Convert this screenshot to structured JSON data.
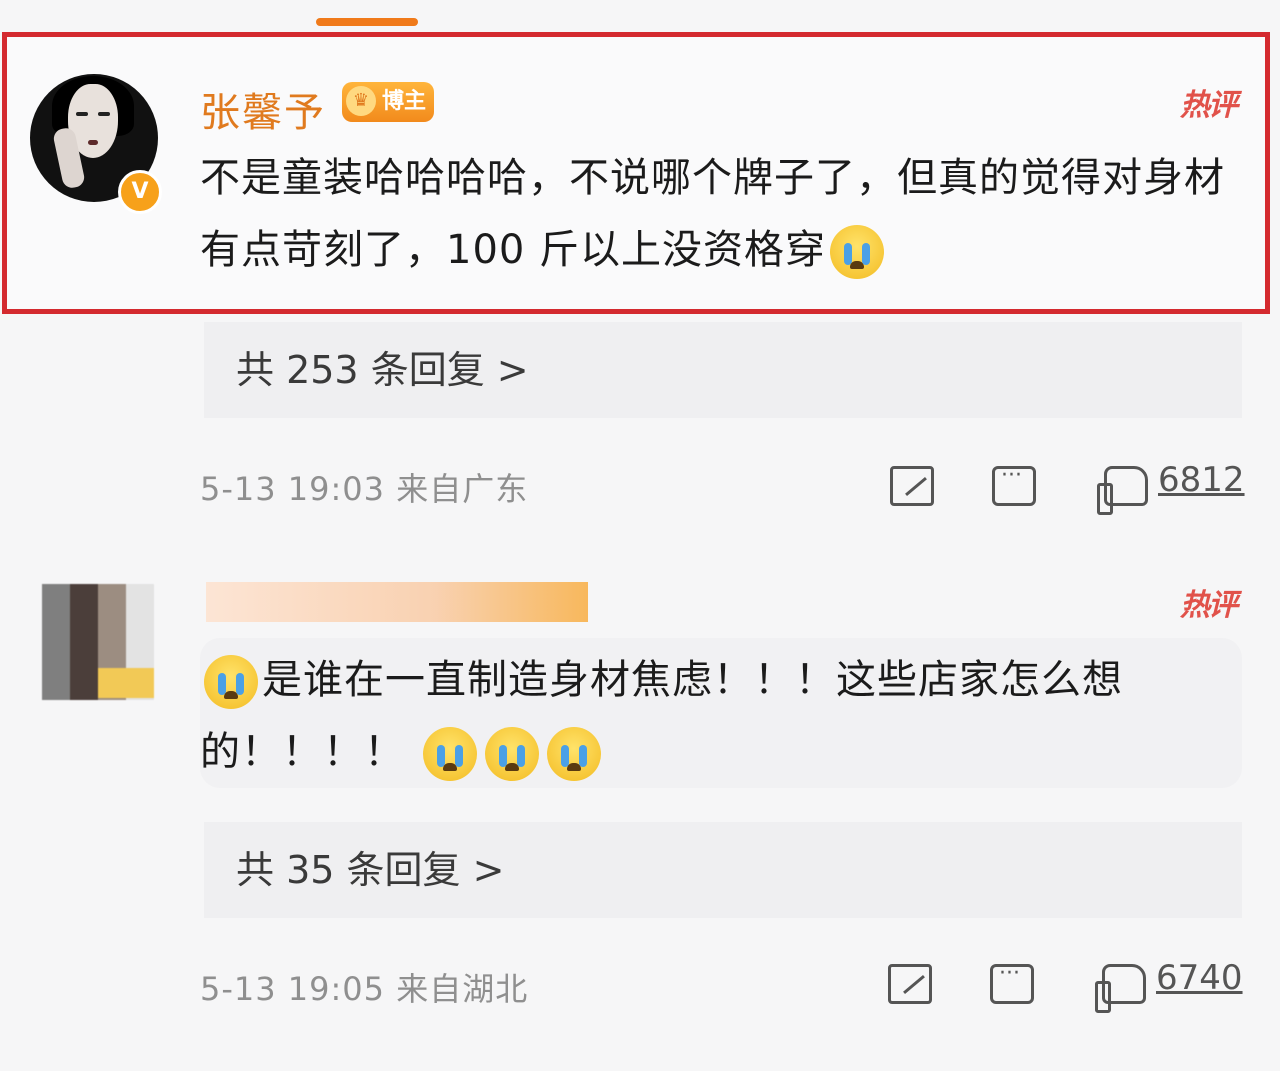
{
  "colors": {
    "accent": "#f07a1a",
    "highlight_border": "#d42a2f",
    "hot": "#e1524a",
    "meta": "#8f8f8f"
  },
  "comments": [
    {
      "username": "张馨予",
      "badge": "博主",
      "hot_tag": "热评",
      "text_part1": "不是童装哈哈哈哈，不说哪个牌子了，但真的觉得对身材有点苛刻了，100 斤以上没资格穿",
      "emoji": "crying-emoji",
      "replies": "共 253 条回复 >",
      "time": "5-13 19:03",
      "location": "来自广东",
      "likes": "6812"
    },
    {
      "hot_tag": "热评",
      "text_part1": "是谁在一直制造身材焦虑！！！这些店家怎么想的！！！！",
      "emoji": "crying-emoji",
      "replies": "共 35 条回复 >",
      "time": "5-13 19:05",
      "location": "来自湖北",
      "likes": "6740"
    }
  ]
}
